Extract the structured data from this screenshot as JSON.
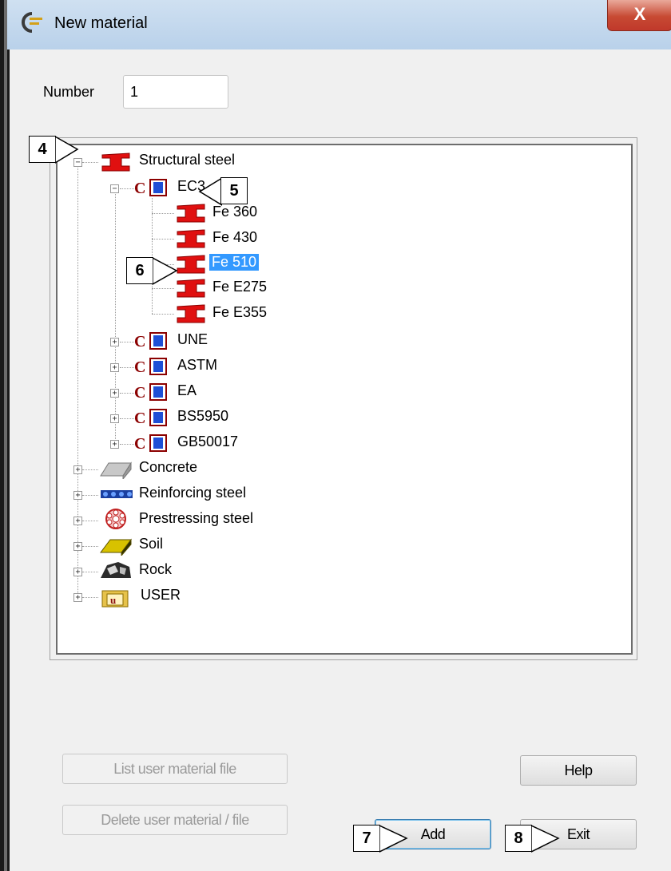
{
  "window": {
    "title": "New material",
    "close_glyph": "X"
  },
  "number": {
    "label": "Number",
    "value": "1"
  },
  "tree": {
    "root_items": [
      {
        "label": "Structural steel",
        "expanded": true,
        "icon": "steel-beam-icon"
      },
      {
        "label": "Concrete",
        "icon": "concrete-block-icon"
      },
      {
        "label": "Reinforcing steel",
        "icon": "rebar-icon"
      },
      {
        "label": "Prestressing steel",
        "icon": "strand-icon"
      },
      {
        "label": "Soil",
        "icon": "soil-icon"
      },
      {
        "label": "Rock",
        "icon": "rock-icon"
      },
      {
        "label": "USER",
        "icon": "user-folder-icon"
      }
    ],
    "codes": [
      "EC3",
      "UNE",
      "ASTM",
      "EA",
      "BS5950",
      "GB50017"
    ],
    "ec3_materials": [
      "Fe 360",
      "Fe 430",
      "Fe 510",
      "Fe E275",
      "Fe E355"
    ],
    "selected": "Fe 510"
  },
  "buttons": {
    "list_user": "List user material file",
    "delete_user": "Delete user material / file",
    "help": "Help",
    "add": "Add",
    "exit": "Exit"
  },
  "callouts": {
    "c4": "4",
    "c5": "5",
    "c6": "6",
    "c7": "7",
    "c8": "8"
  },
  "colors": {
    "selection": "#3399ff",
    "steel_red": "#e01010",
    "code_blue": "#1e4fd6"
  }
}
